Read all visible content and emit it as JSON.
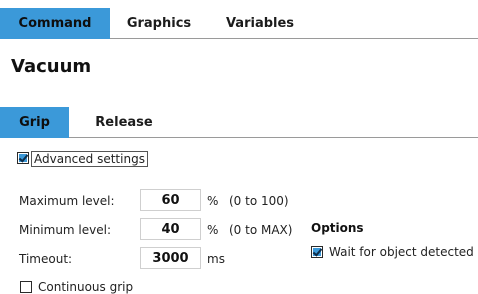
{
  "top_tabs": [
    {
      "label": "Command",
      "active": true
    },
    {
      "label": "Graphics",
      "active": false
    },
    {
      "label": "Variables",
      "active": false
    }
  ],
  "title": "Vacuum",
  "sub_tabs": [
    {
      "label": "Grip",
      "active": true
    },
    {
      "label": "Release",
      "active": false
    }
  ],
  "advanced_settings": {
    "label": "Advanced settings",
    "checked": true
  },
  "fields": {
    "max_level": {
      "label": "Maximum level:",
      "value": "60",
      "unit": "%",
      "range": "(0 to 100)"
    },
    "min_level": {
      "label": "Minimum level:",
      "value": "40",
      "unit": "%",
      "range": "(0 to MAX)"
    },
    "timeout": {
      "label": "Timeout:",
      "value": "3000",
      "unit": "ms"
    }
  },
  "continuous_grip": {
    "label": "Continuous grip",
    "checked": false
  },
  "options": {
    "title": "Options",
    "wait_for_object": {
      "label": "Wait for object detected",
      "checked": true
    }
  },
  "colors": {
    "accent": "#3b99d9",
    "divider": "#9a9a9a"
  }
}
